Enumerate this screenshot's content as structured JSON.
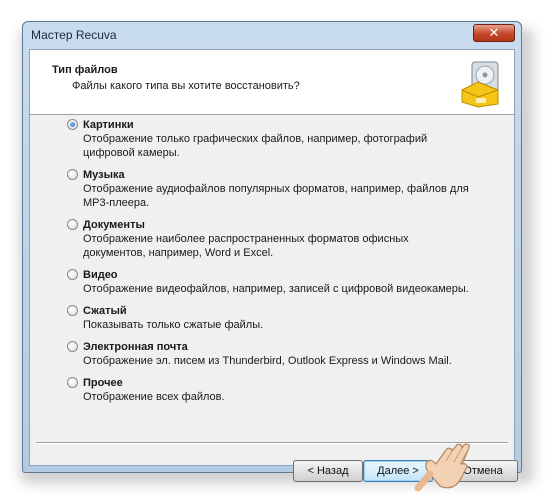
{
  "window": {
    "title": "Мастер Recuva",
    "close_label": "✕"
  },
  "header": {
    "title": "Тип файлов",
    "subtitle": "Файлы какого типа вы хотите восстановить?"
  },
  "options": [
    {
      "label": "Картинки",
      "description": "Отображение только графических файлов, например, фотографий цифровой камеры.",
      "selected": true
    },
    {
      "label": "Музыка",
      "description": "Отображение аудиофайлов популярных форматов, например, файлов для MP3-плеера.",
      "selected": false
    },
    {
      "label": "Документы",
      "description": "Отображение наиболее распространенных форматов офисных документов, например, Word и Excel.",
      "selected": false
    },
    {
      "label": "Видео",
      "description": "Отображение видеофайлов, например, записей с цифровой видеокамеры.",
      "selected": false
    },
    {
      "label": "Сжатый",
      "description": "Показывать только сжатые файлы.",
      "selected": false
    },
    {
      "label": "Электронная почта",
      "description": "Отображение эл. писем из Thunderbird, Outlook Express и Windows Mail.",
      "selected": false
    },
    {
      "label": "Прочее",
      "description": "Отображение всех файлов.",
      "selected": false
    }
  ],
  "buttons": {
    "back": "< Назад",
    "next": "Далее >",
    "cancel": "Отмена"
  },
  "icons": {
    "logo": "recuva-hard-drive-icon",
    "pointer": "hand-pointer-icon"
  }
}
